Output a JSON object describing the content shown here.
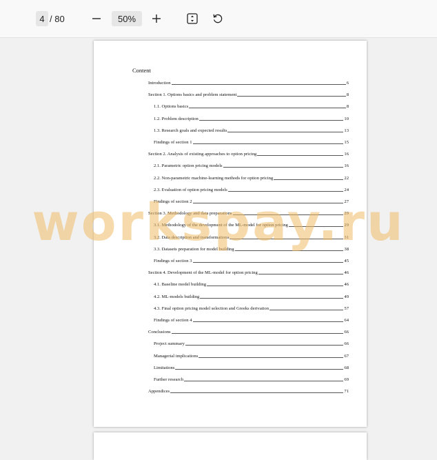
{
  "toolbar": {
    "current_page": "4",
    "total_pages": "/ 80",
    "zoom": "50%",
    "zoom_out_icon": "minus-icon",
    "zoom_in_icon": "plus-icon",
    "fit_icon": "fit-page-icon",
    "rotate_icon": "rotate-icon"
  },
  "document": {
    "toc_title": "Content",
    "entries": [
      {
        "text": "Introduction",
        "page": "6",
        "level": 1
      },
      {
        "text": "Section 1. Options basics and problem statement",
        "page": "8",
        "level": 1
      },
      {
        "text": "1.1. Options basics",
        "page": "8",
        "level": 2
      },
      {
        "text": "1.2. Problem description",
        "page": "10",
        "level": 2
      },
      {
        "text": "1.3. Research goals and expected results",
        "page": "13",
        "level": 2
      },
      {
        "text": "Findings of section 1",
        "page": "15",
        "level": 2
      },
      {
        "text": "Section 2. Analysis of existing approaches to option pricing",
        "page": "16",
        "level": 1
      },
      {
        "text": "2.1. Parametric option pricing models",
        "page": "16",
        "level": 2
      },
      {
        "text": "2.2. Non-parametric machine-learning methods for option pricing",
        "page": "22",
        "level": 2
      },
      {
        "text": "2.3. Evaluation of option pricing models",
        "page": "24",
        "level": 2
      },
      {
        "text": "Findings of section 2",
        "page": "27",
        "level": 2
      },
      {
        "text": "Section 3. Methodology and data preparations",
        "page": "29",
        "level": 1
      },
      {
        "text": "3.1. Methodology of the development of the ML-model for option pricing",
        "page": "29",
        "level": 2
      },
      {
        "text": "3.2. Data description and transformations",
        "page": "31",
        "level": 2
      },
      {
        "text": "3.3. Datasets preparation for model building",
        "page": "38",
        "level": 2
      },
      {
        "text": "Findings of section 3",
        "page": "45",
        "level": 2
      },
      {
        "text": "Section 4. Development of the ML-model for option pricing",
        "page": "46",
        "level": 1
      },
      {
        "text": "4.1. Baseline model building",
        "page": "46",
        "level": 2
      },
      {
        "text": "4.2. ML-models building",
        "page": "49",
        "level": 2
      },
      {
        "text": "4.3. Final option pricing model selection and Greeks derivation",
        "page": "57",
        "level": 2
      },
      {
        "text": "Findings of section 4",
        "page": "64",
        "level": 2
      },
      {
        "text": "Conclusions",
        "page": "66",
        "level": 1
      },
      {
        "text": "Project summary",
        "page": "66",
        "level": 2
      },
      {
        "text": "Managerial implications",
        "page": "67",
        "level": 2
      },
      {
        "text": "Limitations",
        "page": "68",
        "level": 2
      },
      {
        "text": "Further research",
        "page": "69",
        "level": 2
      },
      {
        "text": "Appendices",
        "page": "71",
        "level": 1
      }
    ]
  },
  "watermark": "workspay.ru"
}
